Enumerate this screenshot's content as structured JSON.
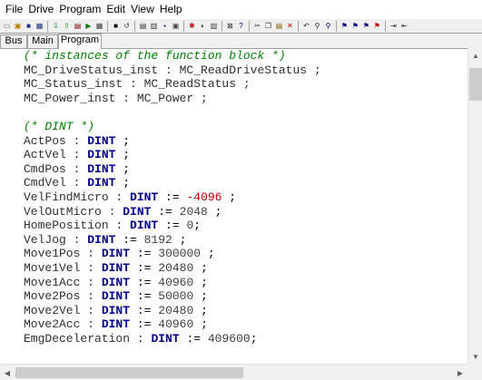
{
  "menu": [
    "File",
    "Drive",
    "Program",
    "Edit",
    "View",
    "Help"
  ],
  "toolbar_icons": [
    {
      "name": "new-file-icon",
      "glyph": "▭",
      "color": "#606060"
    },
    {
      "name": "open-icon",
      "glyph": "▣",
      "color": "#b08000"
    },
    {
      "name": "save-icon",
      "glyph": "■",
      "color": "#203080"
    },
    {
      "name": "save-all-icon",
      "glyph": "▦",
      "color": "#203080"
    },
    {
      "name": "sep"
    },
    {
      "name": "download-icon",
      "glyph": "⇩",
      "color": "#008000"
    },
    {
      "name": "upload-icon",
      "glyph": "⇧",
      "color": "#008000"
    },
    {
      "name": "compile-icon",
      "glyph": "▤",
      "color": "#800000"
    },
    {
      "name": "run-icon",
      "glyph": "▶",
      "color": "#008000"
    },
    {
      "name": "monitor-icon",
      "glyph": "▦",
      "color": "#404040"
    },
    {
      "name": "sep"
    },
    {
      "name": "stop-icon",
      "glyph": "■",
      "color": "#000000"
    },
    {
      "name": "step-icon",
      "glyph": "↺",
      "color": "#404040"
    },
    {
      "name": "sep"
    },
    {
      "name": "print-icon",
      "glyph": "▤",
      "color": "#303030"
    },
    {
      "name": "print-preview-icon",
      "glyph": "▥",
      "color": "#303030"
    },
    {
      "name": "floppy-icon",
      "glyph": "▪",
      "color": "#203080"
    },
    {
      "name": "properties-icon",
      "glyph": "▣",
      "color": "#404040"
    },
    {
      "name": "sep"
    },
    {
      "name": "debug-icon",
      "glyph": "✱",
      "color": "#c00000"
    },
    {
      "name": "break-icon",
      "glyph": "◐",
      "color": "#404040"
    },
    {
      "name": "watch-icon",
      "glyph": "▧",
      "color": "#404040"
    },
    {
      "name": "sep"
    },
    {
      "name": "close-window-icon",
      "glyph": "⊠",
      "color": "#303030"
    },
    {
      "name": "help-icon",
      "glyph": "?",
      "color": "#000080"
    },
    {
      "name": "sep"
    },
    {
      "name": "cut-icon",
      "glyph": "✂",
      "color": "#303030"
    },
    {
      "name": "copy-icon",
      "glyph": "❐",
      "color": "#303030"
    },
    {
      "name": "paste-icon",
      "glyph": "▤",
      "color": "#806000"
    },
    {
      "name": "delete-icon",
      "glyph": "✕",
      "color": "#c00000"
    },
    {
      "name": "sep"
    },
    {
      "name": "undo-icon",
      "glyph": "↶",
      "color": "#303030"
    },
    {
      "name": "find-icon",
      "glyph": "⚲",
      "color": "#303030"
    },
    {
      "name": "find-next-icon",
      "glyph": "⚲",
      "color": "#000080"
    },
    {
      "name": "sep"
    },
    {
      "name": "bookmark-set-icon",
      "glyph": "⚑",
      "color": "#000080"
    },
    {
      "name": "bookmark-next-icon",
      "glyph": "⚑",
      "color": "#000080"
    },
    {
      "name": "bookmark-prev-icon",
      "glyph": "⚑",
      "color": "#000080"
    },
    {
      "name": "bookmark-clear-icon",
      "glyph": "⚑",
      "color": "#c00000"
    },
    {
      "name": "sep"
    },
    {
      "name": "indent-icon",
      "glyph": "⇥",
      "color": "#303030"
    },
    {
      "name": "outdent-icon",
      "glyph": "⇤",
      "color": "#303030"
    }
  ],
  "tabs": [
    {
      "label": "Bus",
      "active": false
    },
    {
      "label": "Main",
      "active": false
    },
    {
      "label": "Program",
      "active": true
    }
  ],
  "code_lines": [
    [
      {
        "t": "(* instances of the function block *)",
        "c": "comment"
      }
    ],
    [
      {
        "t": "MC_DriveStatus_inst : MC_ReadDriveStatus ;",
        "c": ""
      }
    ],
    [
      {
        "t": "MC_Status_inst : MC_ReadStatus ;",
        "c": ""
      }
    ],
    [
      {
        "t": "MC_Power_inst : MC_Power ;",
        "c": ""
      }
    ],
    [],
    [
      {
        "t": "(* DINT *)",
        "c": "comment"
      }
    ],
    [
      {
        "t": "ActPos : ",
        "c": ""
      },
      {
        "t": "DINT",
        "c": "kw"
      },
      {
        "t": " ;",
        "c": "op"
      }
    ],
    [
      {
        "t": "ActVel : ",
        "c": ""
      },
      {
        "t": "DINT",
        "c": "kw"
      },
      {
        "t": " ;",
        "c": "op"
      }
    ],
    [
      {
        "t": "CmdPos : ",
        "c": ""
      },
      {
        "t": "DINT",
        "c": "kw"
      },
      {
        "t": " ;",
        "c": "op"
      }
    ],
    [
      {
        "t": "CmdVel : ",
        "c": ""
      },
      {
        "t": "DINT",
        "c": "kw"
      },
      {
        "t": " ;",
        "c": "op"
      }
    ],
    [
      {
        "t": "VelFindMicro : ",
        "c": ""
      },
      {
        "t": "DINT",
        "c": "kw"
      },
      {
        "t": " := ",
        "c": "op"
      },
      {
        "t": "-4096",
        "c": "neg"
      },
      {
        "t": " ;",
        "c": "op"
      }
    ],
    [
      {
        "t": "VelOutMicro : ",
        "c": ""
      },
      {
        "t": "DINT",
        "c": "kw"
      },
      {
        "t": " := ",
        "c": "op"
      },
      {
        "t": "2048",
        "c": "num"
      },
      {
        "t": " ;",
        "c": "op"
      }
    ],
    [
      {
        "t": "HomePosition : ",
        "c": ""
      },
      {
        "t": "DINT",
        "c": "kw"
      },
      {
        "t": " := ",
        "c": "op"
      },
      {
        "t": "0",
        "c": "num"
      },
      {
        "t": ";",
        "c": "op"
      }
    ],
    [
      {
        "t": "VelJog : ",
        "c": ""
      },
      {
        "t": "DINT",
        "c": "kw"
      },
      {
        "t": " := ",
        "c": "op"
      },
      {
        "t": "8192",
        "c": "num"
      },
      {
        "t": " ;",
        "c": "op"
      }
    ],
    [
      {
        "t": "Move1Pos : ",
        "c": ""
      },
      {
        "t": "DINT",
        "c": "kw"
      },
      {
        "t": " := ",
        "c": "op"
      },
      {
        "t": "300000",
        "c": "num"
      },
      {
        "t": " ;",
        "c": "op"
      }
    ],
    [
      {
        "t": "Move1Vel : ",
        "c": ""
      },
      {
        "t": "DINT",
        "c": "kw"
      },
      {
        "t": " := ",
        "c": "op"
      },
      {
        "t": "20480",
        "c": "num"
      },
      {
        "t": " ;",
        "c": "op"
      }
    ],
    [
      {
        "t": "Move1Acc : ",
        "c": ""
      },
      {
        "t": "DINT",
        "c": "kw"
      },
      {
        "t": " := ",
        "c": "op"
      },
      {
        "t": "40960",
        "c": "num"
      },
      {
        "t": " ;",
        "c": "op"
      }
    ],
    [
      {
        "t": "Move2Pos : ",
        "c": ""
      },
      {
        "t": "DINT",
        "c": "kw"
      },
      {
        "t": " := ",
        "c": "op"
      },
      {
        "t": "50000",
        "c": "num"
      },
      {
        "t": " ;",
        "c": "op"
      }
    ],
    [
      {
        "t": "Move2Vel : ",
        "c": ""
      },
      {
        "t": "DINT",
        "c": "kw"
      },
      {
        "t": " := ",
        "c": "op"
      },
      {
        "t": "20480",
        "c": "num"
      },
      {
        "t": " ;",
        "c": "op"
      }
    ],
    [
      {
        "t": "Move2Acc : ",
        "c": ""
      },
      {
        "t": "DINT",
        "c": "kw"
      },
      {
        "t": " := ",
        "c": "op"
      },
      {
        "t": "40960",
        "c": "num"
      },
      {
        "t": " ;",
        "c": "op"
      }
    ],
    [
      {
        "t": "EmgDeceleration : ",
        "c": ""
      },
      {
        "t": "DINT",
        "c": "kw"
      },
      {
        "t": " := ",
        "c": "op"
      },
      {
        "t": "409600",
        "c": "num"
      },
      {
        "t": ";",
        "c": "op"
      }
    ]
  ],
  "scrollbars": {
    "up": "▲",
    "down": "▼",
    "left": "◀",
    "right": "▶"
  },
  "colors": {
    "comment": "#008000",
    "keyword": "#00008b",
    "negative": "#c00000"
  }
}
